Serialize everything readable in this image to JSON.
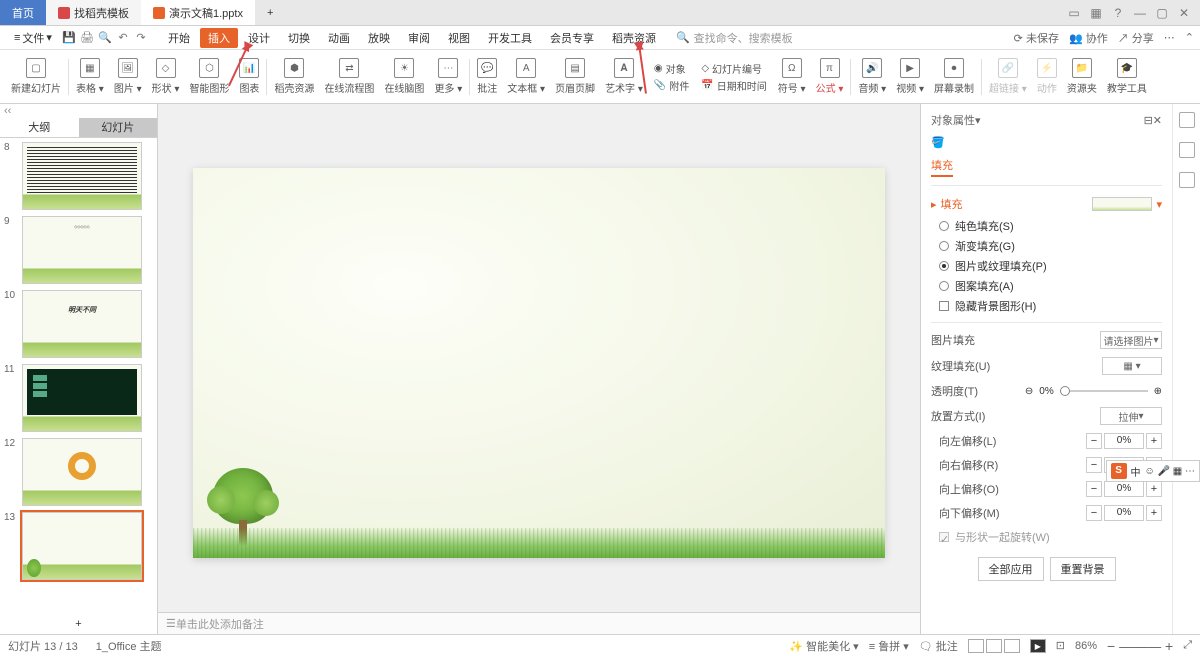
{
  "tabs": {
    "home": "首页",
    "template": "找稻壳模板",
    "file": "演示文稿1.pptx"
  },
  "menu": {
    "file_btn": "文件",
    "begin": "开始",
    "insert": "插入",
    "design": "设计",
    "transition": "切换",
    "anim": "动画",
    "show": "放映",
    "review": "审阅",
    "view": "视图",
    "dev": "开发工具",
    "vip": "会员专享",
    "dk": "稻壳资源",
    "search_placeholder": "查找命令、搜索模板",
    "unsaved": "未保存",
    "coop": "协作",
    "share": "分享"
  },
  "ribbon": {
    "new_slide": "新建幻灯片",
    "table": "表格",
    "image": "图片",
    "shape": "形状",
    "smart": "智能图形",
    "chart": "图表",
    "dkres": "稻壳资源",
    "olflow": "在线流程图",
    "olmind": "在线脑图",
    "more": "更多",
    "comment": "批注",
    "textbox": "文本框",
    "hf": "页眉页脚",
    "wordart": "艺术字",
    "obj": "对象",
    "snd": "幻灯片编号",
    "attach": "附件",
    "datetime": "日期和时间",
    "symbol": "符号",
    "formula": "公式",
    "audio": "音频",
    "video": "视频",
    "record": "屏幕录制",
    "link": "超链接",
    "action": "动作",
    "resfolder": "资源夹",
    "teach": "教学工具"
  },
  "thumbs": {
    "tab_outline": "大纲",
    "tab_slides": "幻灯片",
    "nums": [
      "8",
      "9",
      "10",
      "11",
      "12",
      "13"
    ]
  },
  "notes_placeholder": "单击此处添加备注",
  "props": {
    "header": "对象属性",
    "tab_fill": "填充",
    "sect_fill": "填充",
    "r_solid": "纯色填充(S)",
    "r_grad": "渐变填充(G)",
    "r_pic": "图片或纹理填充(P)",
    "r_pattern": "图案填充(A)",
    "cb_hidebg": "隐藏背景图形(H)",
    "pic_fill": "图片填充",
    "pic_sel": "请选择图片",
    "tex_fill": "纹理填充(U)",
    "opacity": "透明度(T)",
    "opacity_val": "0%",
    "tile": "放置方式(I)",
    "tile_val": "拉伸",
    "off_l": "向左偏移(L)",
    "off_r": "向右偏移(R)",
    "off_u": "向上偏移(O)",
    "off_d": "向下偏移(M)",
    "off_val": "0%",
    "rotate": "与形状一起旋转(W)",
    "apply_all": "全部应用",
    "reset_bg": "重置背景"
  },
  "status": {
    "page": "幻灯片 13 / 13",
    "theme": "1_Office 主题",
    "beautify": "智能美化",
    "typeset": "鲁拼",
    "notes": "批注",
    "zoom": "86%"
  },
  "ime": {
    "ch": "中"
  }
}
